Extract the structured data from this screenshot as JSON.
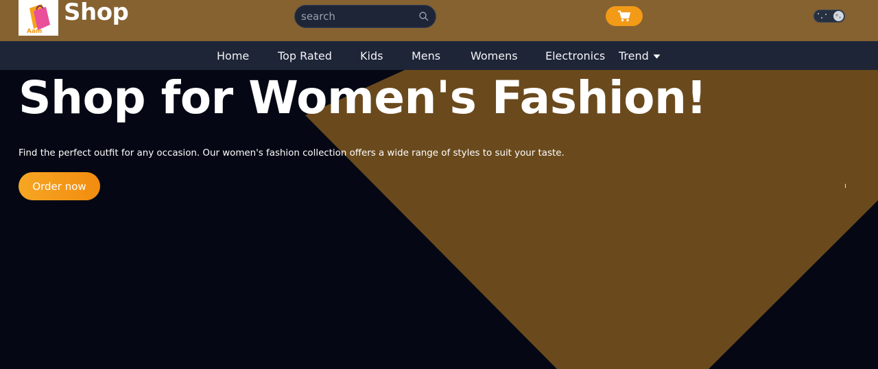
{
  "header": {
    "brand": "Shop",
    "logo_alt": "Shop logo",
    "logo_text": "Aam",
    "search": {
      "placeholder": "search",
      "value": ""
    },
    "icons": {
      "search": "search-icon",
      "cart": "cart-icon",
      "theme_toggle": "dark-mode-toggle"
    }
  },
  "nav": {
    "items": [
      "Home",
      "Top Rated",
      "Kids",
      "Mens",
      "Womens",
      "Electronics"
    ],
    "dropdown": {
      "label": "Trend",
      "icon": "caret-down-icon"
    }
  },
  "hero": {
    "title": "Shop for Women's Fashion!",
    "description": "Find the perfect outfit for any occasion. Our women's fashion collection offers a wide range of styles to suit your taste.",
    "cta": "Order now"
  },
  "colors": {
    "header_bg": "#866230",
    "nav_bg": "#1e2537",
    "page_bg": "#050814",
    "hero_shape": "#6a4a1d",
    "accent": "#f39a17",
    "text": "#ffffff"
  }
}
